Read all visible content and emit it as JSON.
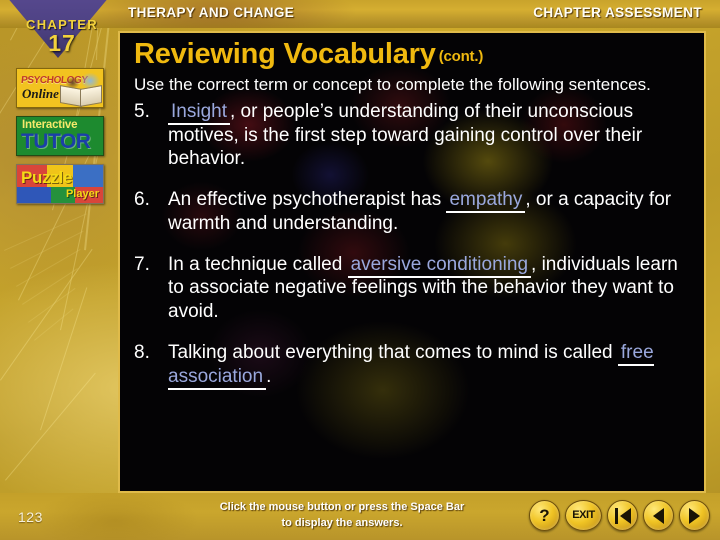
{
  "header": {
    "left_title": "THERAPY AND CHANGE",
    "right_title": "CHAPTER ASSESSMENT"
  },
  "chapter_badge": {
    "label": "CHAPTER",
    "number": "17"
  },
  "sidebar": {
    "buttons": [
      {
        "name": "psychology-online",
        "line1": "PSYCHOLOGY",
        "line2": "Online"
      },
      {
        "name": "interactive-tutor",
        "line1": "Interactive",
        "line2": "TUTOR"
      },
      {
        "name": "puzzle-player",
        "line1": "Puzzle",
        "line2": "Player"
      }
    ]
  },
  "main": {
    "title": "Reviewing Vocabulary",
    "title_suffix": "(cont.)",
    "instructions": "Use the correct term or concept to complete the following sentences.",
    "questions": [
      {
        "number": "5.",
        "before": "",
        "answer": "Insight",
        "after": ", or people’s understanding of their unconscious motives, is the first step toward gaining control over their behavior."
      },
      {
        "number": "6.",
        "before": "An effective psychotherapist has ",
        "answer": "empathy",
        "after": ", or a capacity for warmth and understanding."
      },
      {
        "number": "7.",
        "before": "In a technique called ",
        "answer": "aversive conditioning",
        "after": ", individuals learn to associate negative feelings with the behavior they want to avoid."
      },
      {
        "number": "8.",
        "before": "Talking about everything that comes to mind is called ",
        "answer": "free association",
        "after": "."
      }
    ]
  },
  "footer": {
    "page_number": "123",
    "hint_line1": "Click the mouse button or press the Space Bar",
    "hint_line2": "to display the answers.",
    "nav_buttons": [
      {
        "name": "help-button",
        "glyph": "?"
      },
      {
        "name": "exit-button",
        "glyph": "EXIT"
      },
      {
        "name": "first-page-button",
        "glyph": "first"
      },
      {
        "name": "previous-page-button",
        "glyph": "previous"
      },
      {
        "name": "next-page-button",
        "glyph": "next"
      }
    ]
  },
  "colors": {
    "gold_background": "#c9a62c",
    "title_gold": "#f0b90f",
    "answer_blue": "#9aa8dd",
    "panel_black": "#050305",
    "badge_purple": "#4e4284"
  }
}
